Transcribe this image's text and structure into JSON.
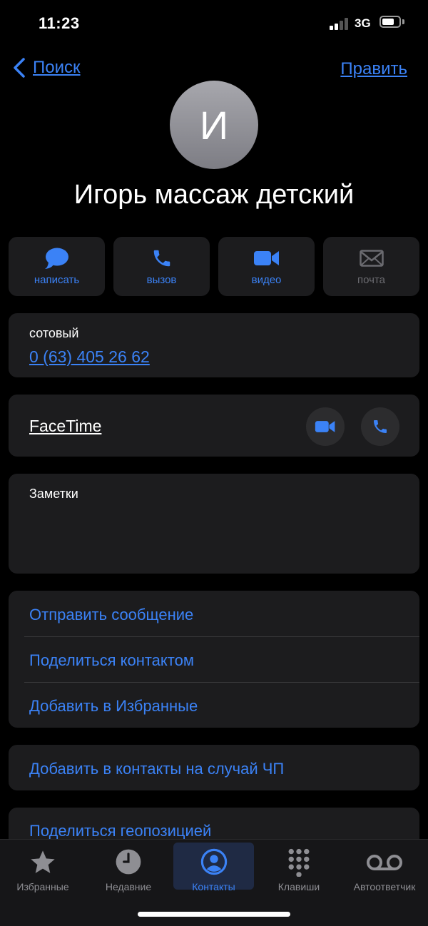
{
  "status": {
    "time": "11:23",
    "network": "3G"
  },
  "nav": {
    "back_label": "Поиск",
    "edit_label": "Править"
  },
  "contact": {
    "initial": "И",
    "name": "Игорь массаж детский"
  },
  "actions": [
    {
      "label": "написать",
      "icon": "message-icon",
      "enabled": true
    },
    {
      "label": "вызов",
      "icon": "phone-icon",
      "enabled": true
    },
    {
      "label": "видео",
      "icon": "video-icon",
      "enabled": true
    },
    {
      "label": "почта",
      "icon": "mail-icon",
      "enabled": false
    }
  ],
  "phone_field": {
    "label": "сотовый",
    "value": "0 (63) 405 26 62"
  },
  "facetime": {
    "label": "FaceTime"
  },
  "notes": {
    "label": "Заметки"
  },
  "links": {
    "send_message": "Отправить сообщение",
    "share_contact": "Поделиться контактом",
    "add_favorites": "Добавить в Избранные",
    "add_emergency": "Добавить в контакты на случай ЧП",
    "share_location": "Поделиться геопозицией"
  },
  "tabs": [
    {
      "label": "Избранные",
      "icon": "star-icon",
      "active": false
    },
    {
      "label": "Недавние",
      "icon": "clock-icon",
      "active": false
    },
    {
      "label": "Контакты",
      "icon": "contact-icon",
      "active": true
    },
    {
      "label": "Клавиши",
      "icon": "keypad-icon",
      "active": false
    },
    {
      "label": "Автоответчик",
      "icon": "voicemail-icon",
      "active": false
    }
  ],
  "colors": {
    "accent": "#3b82f6",
    "card": "#1c1c1e",
    "background": "#000000"
  }
}
